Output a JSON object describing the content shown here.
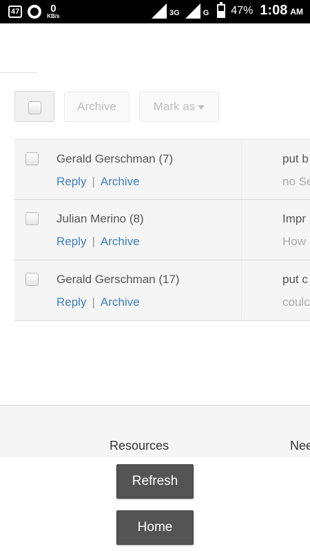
{
  "status_bar": {
    "notification_badge": "47",
    "speed_value": "0",
    "speed_unit": "KB/s",
    "network_type_1": "3G",
    "network_type_2": "G",
    "battery_percent": "47%",
    "battery_level": 0.47,
    "time": "1:08",
    "ampm": "AM"
  },
  "toolbar": {
    "archive_label": "Archive",
    "mark_as_label": "Mark as"
  },
  "messages": [
    {
      "sender": "Gerald Gerschman (7)",
      "reply": "Reply",
      "archive": "Archive",
      "subject": "put b",
      "preview": "no Se"
    },
    {
      "sender": "Julian Merino (8)",
      "reply": "Reply",
      "archive": "Archive",
      "subject": "Impr",
      "preview": "How"
    },
    {
      "sender": "Gerald Gerschman (17)",
      "reply": "Reply",
      "archive": "Archive",
      "subject": "put c",
      "preview": "coulc"
    }
  ],
  "separator": "|",
  "footer": {
    "resources_heading": "Resources",
    "next_heading": "Nee"
  },
  "buttons": {
    "refresh": "Refresh",
    "home": "Home"
  },
  "colors": {
    "link": "#3d7fc1",
    "button_bg": "#545454",
    "row_bg": "#f5f5f5"
  }
}
